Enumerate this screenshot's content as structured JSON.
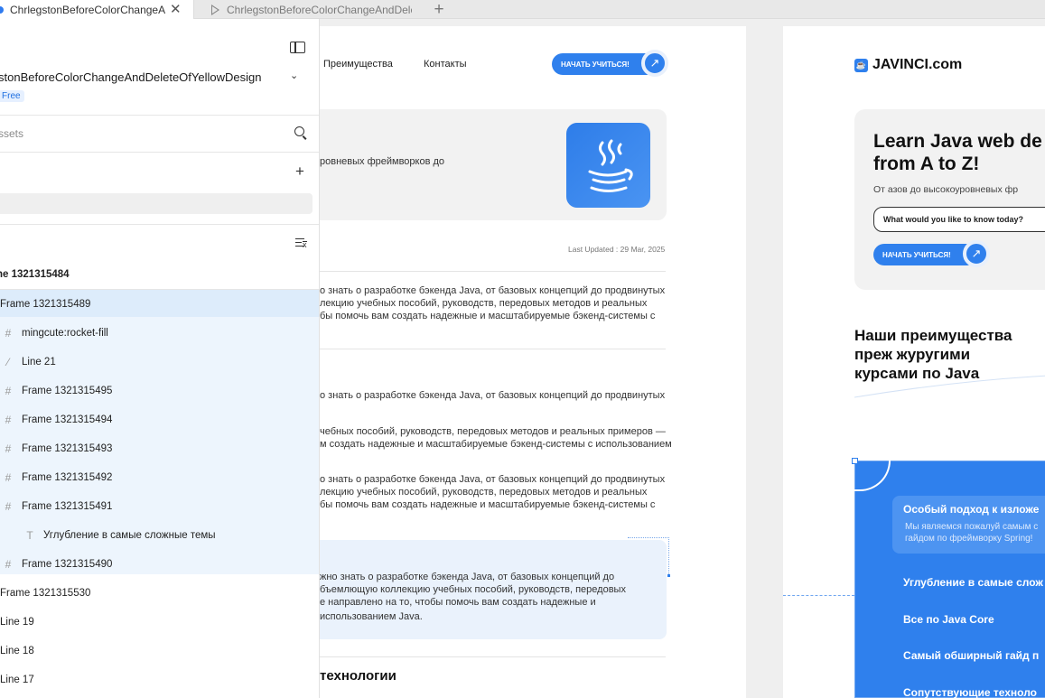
{
  "tabs": {
    "active": "ChrlegstonBeforeColorChangeAndDeleteOfYellowDesign",
    "second": "ChrlegstonBeforeColorChangeAndDeleteOfYellowDesign",
    "add_icon": "plus-icon"
  },
  "panel": {
    "file_name": "stonBeforeColorChangeAndDeleteOfYellowDesign",
    "plan": "Free",
    "assets_placeholder": "ssets",
    "root_frame": "ne 1321315484",
    "layers": [
      {
        "label": "Frame 1321315489",
        "icon": "frame-icon"
      },
      {
        "label": "mingcute:rocket-fill",
        "icon": "frame-icon"
      },
      {
        "label": "Line 21",
        "icon": "line-icon"
      },
      {
        "label": "Frame 1321315495",
        "icon": "frame-icon"
      },
      {
        "label": "Frame 1321315494",
        "icon": "frame-icon"
      },
      {
        "label": "Frame 1321315493",
        "icon": "frame-icon"
      },
      {
        "label": "Frame 1321315492",
        "icon": "frame-icon"
      },
      {
        "label": "Frame 1321315491",
        "icon": "frame-icon"
      },
      {
        "label": "Углубление в самые сложные темы",
        "icon": "text-icon"
      },
      {
        "label": "Frame 1321315490",
        "icon": "frame-icon"
      },
      {
        "label": "Frame 1321315530",
        "icon": "frame-icon"
      },
      {
        "label": "Line 19",
        "icon": "line-icon"
      },
      {
        "label": "Line 18",
        "icon": "line-icon"
      },
      {
        "label": "Line 17",
        "icon": "line-icon"
      }
    ]
  },
  "left_page": {
    "nav_advantages": "Преимущества",
    "nav_contacts": "Контакты",
    "cta": "НАЧАТЬ УЧИТЬСЯ!",
    "hero_text": "ровневых фреймворков   до",
    "last_updated": "Last Updated : 29 Mar, 2025",
    "para1": [
      "о знать о разработке бэкенда Java, от базовых концепций до продвинутых",
      "лекцию учебных пособий, руководств, передовых методов и реальных",
      "бы помочь вам создать надежные и масштабируемые бэкенд-системы с"
    ],
    "para2": [
      "о знать о разработке бэкенда Java, от базовых концепций до продвинутых"
    ],
    "para3": [
      "чебных пособий, руководств, передовых методов и реальных примеров —",
      "м создать надежные и масштабируемые бэкенд-системы с использованием"
    ],
    "para4": [
      "о знать о разработке бэкенда Java, от базовых концепций до продвинутых",
      "лекцию учебных пособий, руководств, передовых методов и реальных",
      "бы помочь вам создать надежные и масштабируемые бэкенд-системы с"
    ],
    "para5": [
      "жно знать о разработке бэкенда Java, от базовых концепций до",
      "бъемлющую коллекцию учебных пособий, руководств, передовых",
      "е направлено на то, чтобы помочь вам создать надежные и",
      "использованием Java."
    ],
    "section_heading": "технологии"
  },
  "right_page": {
    "brand": "JAVINCI.com",
    "hero_title_1": "Learn Java web de",
    "hero_title_2": "from A to Z!",
    "hero_sub": "От азов до высокоуровневых фр",
    "input_placeholder": "What would you like to know today?",
    "cta": "НАЧАТЬ УЧИТЬСЯ!",
    "advantages_1": "Наши преимущества",
    "advantages_2": "преж журугими",
    "advantages_3": "курсами по Java",
    "feature_title": "Особый подход к изложе",
    "feature_sub_1": "Мы являемся пожалуй самым с",
    "feature_sub_2": "гайдом по фреймворку Spring!",
    "items": [
      "Углубление в самые слож",
      "Все по Java Core",
      "Самый обширный гайд п",
      "Сопутствующие техноло"
    ]
  },
  "colors": {
    "accent": "#2f80ed",
    "selection": "#ddecfb"
  }
}
